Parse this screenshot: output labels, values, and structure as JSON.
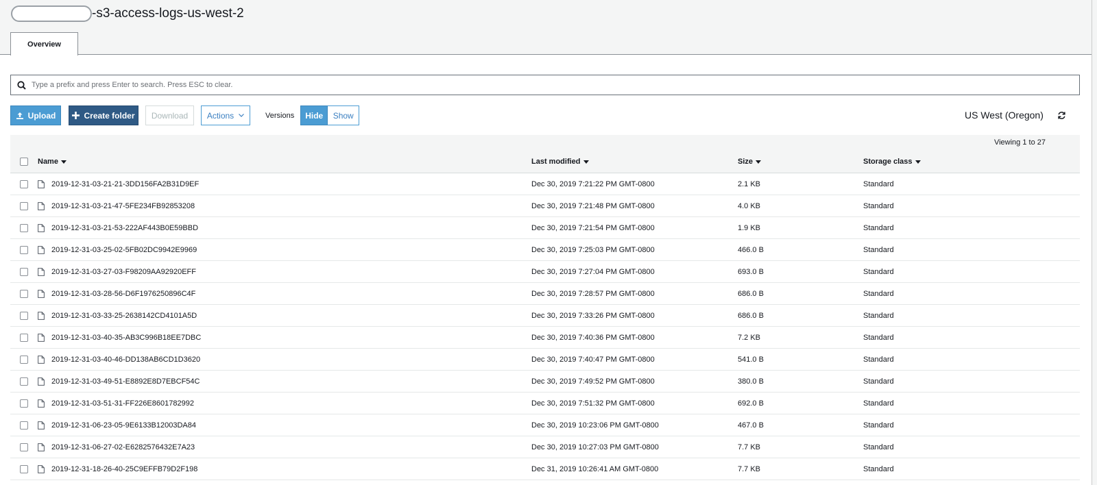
{
  "bucket": {
    "title_suffix": "-s3-access-logs-us-west-2"
  },
  "tabs": [
    {
      "label": "Overview"
    }
  ],
  "search": {
    "placeholder": "Type a prefix and press Enter to search. Press ESC to clear."
  },
  "toolbar": {
    "upload_label": "Upload",
    "create_folder_label": "Create folder",
    "download_label": "Download",
    "actions_label": "Actions",
    "versions_label": "Versions",
    "hide_label": "Hide",
    "show_label": "Show"
  },
  "region": "US West (Oregon)",
  "viewing": "Viewing 1 to 27",
  "columns": {
    "name": "Name",
    "last_modified": "Last modified",
    "size": "Size",
    "storage_class": "Storage class"
  },
  "colors": {
    "primary": "#4b9cd3",
    "dark_primary": "#2f5a85",
    "header_bg": "#f4f5f5"
  },
  "icons": {
    "search": "search-icon",
    "upload": "upload-icon",
    "plus": "plus-icon",
    "chevron": "chevron-down-icon",
    "refresh": "refresh-icon",
    "file": "file-icon"
  },
  "rows": [
    {
      "name": "2019-12-31-03-21-21-3DD156FA2B31D9EF",
      "modified": "Dec 30, 2019 7:21:22 PM GMT-0800",
      "size": "2.1 KB",
      "class": "Standard"
    },
    {
      "name": "2019-12-31-03-21-47-5FE234FB92853208",
      "modified": "Dec 30, 2019 7:21:48 PM GMT-0800",
      "size": "4.0 KB",
      "class": "Standard"
    },
    {
      "name": "2019-12-31-03-21-53-222AF443B0E59BBD",
      "modified": "Dec 30, 2019 7:21:54 PM GMT-0800",
      "size": "1.9 KB",
      "class": "Standard"
    },
    {
      "name": "2019-12-31-03-25-02-5FB02DC9942E9969",
      "modified": "Dec 30, 2019 7:25:03 PM GMT-0800",
      "size": "466.0 B",
      "class": "Standard"
    },
    {
      "name": "2019-12-31-03-27-03-F98209AA92920EFF",
      "modified": "Dec 30, 2019 7:27:04 PM GMT-0800",
      "size": "693.0 B",
      "class": "Standard"
    },
    {
      "name": "2019-12-31-03-28-56-D6F1976250896C4F",
      "modified": "Dec 30, 2019 7:28:57 PM GMT-0800",
      "size": "686.0 B",
      "class": "Standard"
    },
    {
      "name": "2019-12-31-03-33-25-2638142CD4101A5D",
      "modified": "Dec 30, 2019 7:33:26 PM GMT-0800",
      "size": "686.0 B",
      "class": "Standard"
    },
    {
      "name": "2019-12-31-03-40-35-AB3C996B18EE7DBC",
      "modified": "Dec 30, 2019 7:40:36 PM GMT-0800",
      "size": "7.2 KB",
      "class": "Standard"
    },
    {
      "name": "2019-12-31-03-40-46-DD138AB6CD1D3620",
      "modified": "Dec 30, 2019 7:40:47 PM GMT-0800",
      "size": "541.0 B",
      "class": "Standard"
    },
    {
      "name": "2019-12-31-03-49-51-E8892E8D7EBCF54C",
      "modified": "Dec 30, 2019 7:49:52 PM GMT-0800",
      "size": "380.0 B",
      "class": "Standard"
    },
    {
      "name": "2019-12-31-03-51-31-FF226E8601782992",
      "modified": "Dec 30, 2019 7:51:32 PM GMT-0800",
      "size": "692.0 B",
      "class": "Standard"
    },
    {
      "name": "2019-12-31-06-23-05-9E6133B12003DA84",
      "modified": "Dec 30, 2019 10:23:06 PM GMT-0800",
      "size": "467.0 B",
      "class": "Standard"
    },
    {
      "name": "2019-12-31-06-27-02-E6282576432E7A23",
      "modified": "Dec 30, 2019 10:27:03 PM GMT-0800",
      "size": "7.7 KB",
      "class": "Standard"
    },
    {
      "name": "2019-12-31-18-26-40-25C9EFFB79D2F198",
      "modified": "Dec 31, 2019 10:26:41 AM GMT-0800",
      "size": "7.7 KB",
      "class": "Standard"
    }
  ]
}
